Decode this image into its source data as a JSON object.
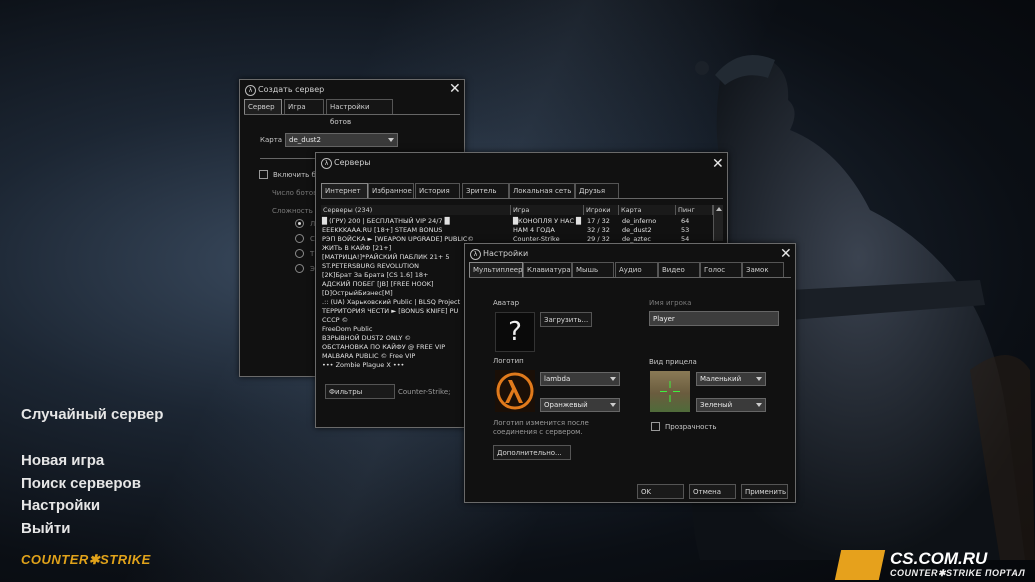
{
  "menu": {
    "random_server": "Случайный сервер",
    "new_game": "Новая игра",
    "find_servers": "Поиск серверов",
    "settings": "Настройки",
    "exit": "Выйти"
  },
  "logo": {
    "game": "COUNTER✱STRIKE"
  },
  "badge": {
    "site": "CS.COM.RU",
    "tagline": "COUNTER✱STRIKE ПОРТАЛ"
  },
  "create_server": {
    "title": "Создать сервер",
    "tabs": [
      "Сервер",
      "Игра",
      "Настройки ботов"
    ],
    "map_label": "Карта",
    "map_value": "de_dust2",
    "enable_bots": "Включить бо",
    "bot_count": "Число ботов",
    "difficulty": "Сложность",
    "radio_labels": [
      "Л",
      "С",
      "Т",
      "Э"
    ]
  },
  "servers": {
    "title": "Серверы",
    "tabs": [
      "Интернет",
      "Избранное",
      "История",
      "Зритель",
      "Локальная сеть",
      "Друзья"
    ],
    "columns": [
      "Серверы (234)",
      "Игра",
      "Игроки",
      "Карта",
      "Пинг"
    ],
    "rows": [
      {
        "name": "█ (ГРУ) 200 | БЕСПЛАТНЫЙ VIP 24/7 █",
        "game": "█КОНОПЛЯ У НАС █",
        "players": "17 / 32",
        "map": "de_inferno",
        "ping": "64"
      },
      {
        "name": "EEEKKKAAA.RU [18+] STEAM BONUS",
        "game": "НАМ 4 ГОДА",
        "players": "32 / 32",
        "map": "de_dust2",
        "ping": "53"
      },
      {
        "name": "РЭП ВОЙСКА ► [WEAPON UPGRADE] PUBLIC©",
        "game": "Counter-Strike",
        "players": "29 / 32",
        "map": "de_aztec",
        "ping": "54"
      },
      {
        "name": "ЖИТЬ В КАЙФ [21+]",
        "game": "",
        "players": "",
        "map": "",
        "ping": ""
      },
      {
        "name": "[МАТРИЦА!]*РАЙСКИЙ ПАБЛИК 21+ 5",
        "game": "",
        "players": "",
        "map": "",
        "ping": ""
      },
      {
        "name": "ST.PETERSBURG REVOLUTION",
        "game": "",
        "players": "",
        "map": "",
        "ping": ""
      },
      {
        "name": "[2K]Брат За Брата [CS 1.6] 18+",
        "game": "",
        "players": "",
        "map": "",
        "ping": ""
      },
      {
        "name": "АДСКИЙ ПОБЕГ [JB] [FREE HOOK]",
        "game": "",
        "players": "",
        "map": "",
        "ping": ""
      },
      {
        "name": "[D]ОстрыйБизнес[M]",
        "game": "",
        "players": "",
        "map": "",
        "ping": ""
      },
      {
        "name": ".:: (UA) Харьковский Public | BLSQ Project",
        "game": "",
        "players": "",
        "map": "",
        "ping": ""
      },
      {
        "name": "ТЕРРИТОРИЯ ЧЕСТИ ► [BONUS KNIFE] PU",
        "game": "",
        "players": "",
        "map": "",
        "ping": ""
      },
      {
        "name": "CCCP ©",
        "game": "",
        "players": "",
        "map": "",
        "ping": ""
      },
      {
        "name": "FreeDom Public",
        "game": "",
        "players": "",
        "map": "",
        "ping": ""
      },
      {
        "name": "ВЗРЫВНОЙ DUST2 ONLY ©",
        "game": "",
        "players": "",
        "map": "",
        "ping": ""
      },
      {
        "name": "ОБСТАНОВКА ПО КАЙФУ @ FREE VIP",
        "game": "",
        "players": "",
        "map": "",
        "ping": ""
      },
      {
        "name": "MALBARA PUBLIC © Free VIP",
        "game": "",
        "players": "",
        "map": "",
        "ping": ""
      },
      {
        "name": "••• Zombie Plague X •••",
        "game": "",
        "players": "",
        "map": "",
        "ping": ""
      }
    ],
    "filters_button": "Фильтры",
    "filter_game": "Counter-Strike;"
  },
  "settings": {
    "title": "Настройки",
    "tabs": [
      "Мультиплеер",
      "Клавиатура",
      "Мышь",
      "Аудио",
      "Видео",
      "Голос",
      "Замок"
    ],
    "avatar_label": "Аватар",
    "avatar_glyph": "?",
    "upload_button": "Загрузить...",
    "player_name_label": "Имя игрока",
    "player_name_value": "Player",
    "logo_label": "Логотип",
    "logo_dd": "lambda",
    "logo_color_dd": "Оранжевый",
    "logo_note": "Логотип изменится после соединения с сервером.",
    "advanced_button": "Дополнительно...",
    "crosshair_label": "Вид прицела",
    "crosshair_size_dd": "Маленький",
    "crosshair_color_dd": "Зеленый",
    "transparency": "Прозрачность",
    "ok": "OK",
    "cancel": "Отмена",
    "apply": "Применить"
  },
  "colors": {
    "accent_orange": "#e6a11c",
    "logo_orange": "#e07a1c"
  }
}
